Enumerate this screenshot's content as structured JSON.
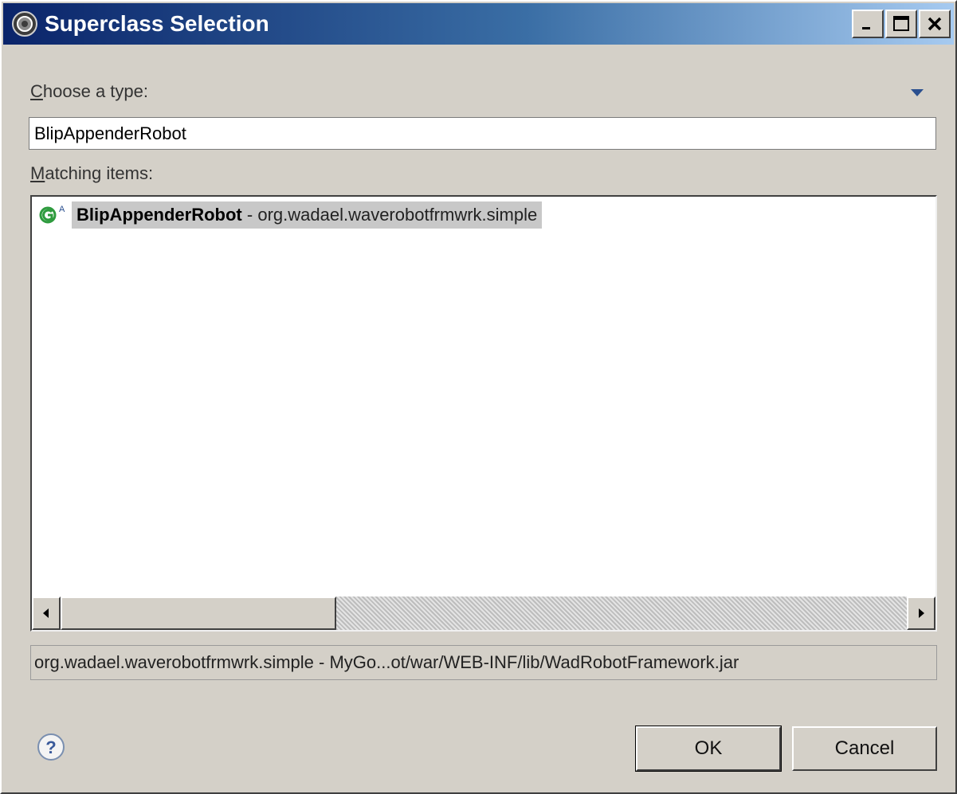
{
  "window": {
    "title": "Superclass Selection",
    "icon": "eclipse-gear-icon",
    "controls": [
      "minimize",
      "maximize",
      "close"
    ]
  },
  "choose": {
    "label_accesskey": "C",
    "label_rest": "hoose a type:",
    "value": "BlipAppenderRobot",
    "menu_icon": "chevron-down-icon"
  },
  "matching": {
    "label_accesskey": "M",
    "label_rest": "atching items:",
    "items": [
      {
        "name": "BlipAppenderRobot",
        "separator": " - ",
        "package": "org.wadael.waverobotfrmwrk.simple",
        "icon": "abstract-class-icon",
        "selected": true
      }
    ]
  },
  "status": {
    "text": "org.wadael.waverobotfrmwrk.simple - MyGo...ot/war/WEB-INF/lib/WadRobotFramework.jar"
  },
  "buttons": {
    "ok": "OK",
    "cancel": "Cancel",
    "help_icon": "help-icon"
  },
  "colors": {
    "titlebar_start": "#0a246a",
    "titlebar_end": "#a6caf0",
    "dialog_bg": "#d4d0c8",
    "selection_bg": "#c8c8c8",
    "class_icon_green": "#2e9b3e"
  }
}
